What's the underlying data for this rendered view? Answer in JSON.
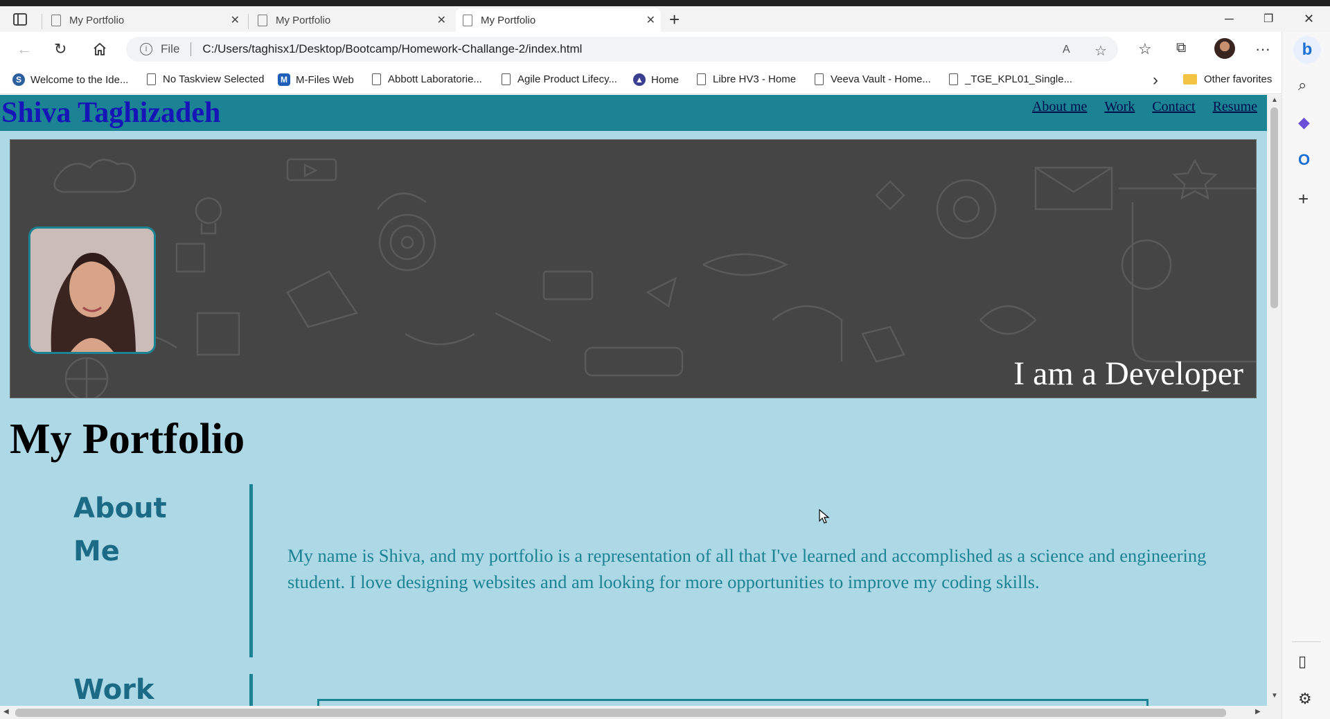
{
  "browser": {
    "tabs": [
      {
        "label": "My Portfolio"
      },
      {
        "label": "My Portfolio"
      },
      {
        "label": "My Portfolio"
      }
    ],
    "address": {
      "file_label": "File",
      "url": "C:/Users/taghisx1/Desktop/Bootcamp/Homework-Challange-2/index.html"
    },
    "favorites": [
      {
        "label": "Welcome to the Ide..."
      },
      {
        "label": "No Taskview Selected"
      },
      {
        "label": "M-Files Web"
      },
      {
        "label": "Abbott Laboratorie..."
      },
      {
        "label": "Agile Product Lifecy..."
      },
      {
        "label": "Home"
      },
      {
        "label": "Libre HV3 - Home"
      },
      {
        "label": "Veeva Vault - Home..."
      },
      {
        "label": "_TGE_KPL01_Single..."
      }
    ],
    "other_favorites": "Other favorites"
  },
  "site": {
    "name": "Shiva Taghizadeh",
    "nav": [
      "About me",
      "Work",
      "Contact",
      "Resume"
    ],
    "hero_text": "I am a Developer",
    "page_title": "My Portfolio",
    "about": {
      "heading": "About Me",
      "text": "My name is Shiva, and my portfolio is a representation of all that I've learned and accomplished as a science and engineering student. I love designing websites and am looking for more opportunities to improve my coding skills."
    },
    "work": {
      "heading": "Work"
    }
  },
  "colors": {
    "header": "#1b8393",
    "page_bg": "#add8e6",
    "site_name": "#1515b8",
    "hero_bg": "#454545",
    "heading": "#1b6b86",
    "body_text": "#1b8393"
  }
}
